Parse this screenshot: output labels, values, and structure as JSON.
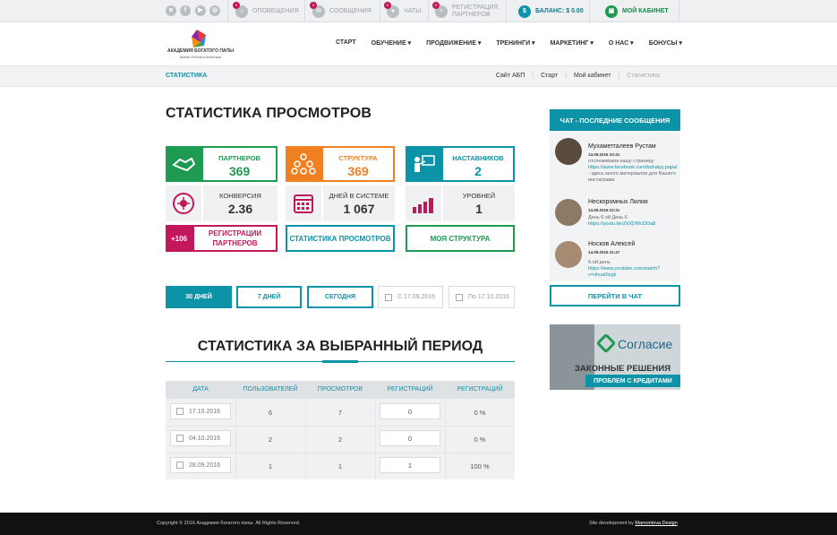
{
  "topbar": {
    "social": [
      "vk-icon",
      "facebook-icon",
      "youtube-icon",
      "instagram-icon"
    ],
    "notifications": {
      "label": "ОПОВЕЩЕНИЯ",
      "badge": "0"
    },
    "messages": {
      "label": "СООБЩЕНИЯ",
      "badge": "0"
    },
    "chats": {
      "label": "ЧАТЫ",
      "badge": "0"
    },
    "registrations": {
      "line1": "РЕГИСТРАЦИЯ",
      "line2": "ПАРТНЕРОВ",
      "badge": "0"
    },
    "balance": "БАЛАНС: $ 0.00",
    "cabinet": "МОЙ КАБИНЕТ"
  },
  "logo": {
    "line1": "АКАДЕМИЯ БОГАТОГО ПАПЫ",
    "line2": "имени Роберта Кийосаки"
  },
  "nav": [
    "СТАРТ",
    "ОБУЧЕНИЕ ▾",
    "ПРОДВИЖЕНИЕ ▾",
    "ТРЕНИНГИ ▾",
    "МАРКЕТИНГ ▾",
    "О НАС ▾",
    "БОНУСЫ ▾"
  ],
  "breadcrumb": {
    "title": "СТАТИСТИКА",
    "items": [
      "Сайт АБП",
      "Старт",
      "Мой кабинет",
      "Статистика"
    ]
  },
  "page_title": "СТАТИСТИКА ПРОСМОТРОВ",
  "stats": {
    "partners": {
      "label": "ПАРТНЕРОВ",
      "value": "369",
      "color": "#1e9a52"
    },
    "structure": {
      "label": "СТРУКТУРА",
      "value": "369",
      "color": "#f08122"
    },
    "mentors": {
      "label": "НАСТАВНИКОВ",
      "value": "2",
      "color": "#0d93a8"
    },
    "conversion": {
      "label": "КОНВЕРСИЯ",
      "value": "2.36"
    },
    "days": {
      "label": "ДНЕЙ В СИСТЕМЕ",
      "value": "1 067"
    },
    "levels": {
      "label": "УРОВНЕЙ",
      "value": "1"
    }
  },
  "buttons": {
    "reg_badge": "+106",
    "reg_label": "РЕГИСТРАЦИИ ПАРТНЕРОВ",
    "views_label": "СТАТИСТИКА ПРОСМОТРОВ",
    "structure_label": "МОЯ СТРУКТУРА"
  },
  "filters": {
    "days30": "30 ДНЕЙ",
    "days7": "7 ДНЕЙ",
    "today": "СЕГОДНЯ",
    "from_placeholder": "С 17.09.2016",
    "to_placeholder": "По 17.10.2016"
  },
  "period_title": "СТАТИСТИКА ЗА ВЫБРАННЫЙ ПЕРИОД",
  "table": {
    "headers": [
      "ДАТА",
      "ПОЛЬЗОВАТЕЛЕЙ",
      "ПРОСМОТРОВ",
      "РЕГИСТРАЦИЙ",
      "РЕГИСТРАЦИЙ"
    ],
    "rows": [
      {
        "date": "17.10.2016",
        "users": "6",
        "views": "7",
        "regs": "0",
        "pct": "0 %"
      },
      {
        "date": "04.10.2016",
        "users": "2",
        "views": "2",
        "regs": "0",
        "pct": "0 %"
      },
      {
        "date": "28.09.2016",
        "users": "1",
        "views": "1",
        "regs": "1",
        "pct": "100 %"
      }
    ]
  },
  "chat": {
    "title": "ЧАТ - ПОСЛЕДНИЕ СООБЩЕНИЯ",
    "messages": [
      {
        "name": "Мухаметгалеев Рустам",
        "date": "14.09.2016 23:41",
        "text1": "отслеживаем нашу страницу",
        "link1": "https://www.facebook.com/bohatyy.papa/",
        "text2": "- здесь много материалов для Вашего инстаграма"
      },
      {
        "name": "Нескоромных Лилия",
        "date": "14.09.2016 22:31",
        "text1": "День 6 ой День 6",
        "link1": "https://youtu.be/ZkXDWcDOa8",
        "text2": ""
      },
      {
        "name": "Носков Алексей",
        "date": "14.09.2016 21:47",
        "text1": "6-ой день",
        "link1": "https://www.youtube.com/watch?v=uhua0Izgk",
        "text2": ""
      }
    ],
    "button": "ПЕРЕЙТИ В ЧАТ"
  },
  "ad": {
    "brand": "Согласие",
    "line1": "ЗАКОННЫЕ РЕШЕНИЯ",
    "line2": "ПРОБЛЕМ С КРЕДИТАМИ"
  },
  "footer": {
    "copyright": "Copyright © 2016 Академия богатого папы. All Rights Reserved.",
    "dev_prefix": "Site development by ",
    "dev_name": "Mamontova Design"
  }
}
